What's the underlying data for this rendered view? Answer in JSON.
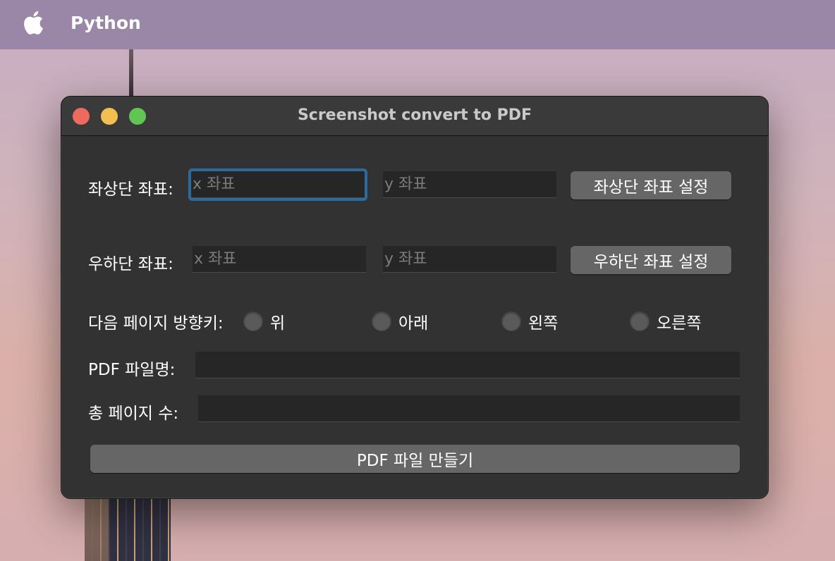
{
  "menubar": {
    "app_name": "Python"
  },
  "window": {
    "title": "Screenshot convert to PDF",
    "top_left": {
      "label": "좌상단 좌표:",
      "x_placeholder": "x 좌표",
      "y_placeholder": "y 좌표",
      "button_label": "좌상단 좌표 설정"
    },
    "bottom_right": {
      "label": "우하단 좌표:",
      "x_placeholder": "x 좌표",
      "y_placeholder": "y 좌표",
      "button_label": "우하단 좌표 설정"
    },
    "direction": {
      "label": "다음 페이지 방향키:",
      "options": [
        "위",
        "아래",
        "왼쪽",
        "오른쪽"
      ]
    },
    "pdf_name": {
      "label": "PDF 파일명:",
      "value": ""
    },
    "total_pages": {
      "label": "총 페이지 수:",
      "value": ""
    },
    "create_button_label": "PDF 파일 만들기"
  },
  "colors": {
    "window_bg": "#323232",
    "focus_ring": "#2a6a9c",
    "button_bg": "#666666",
    "close": "#ed6a5e",
    "minimize": "#f5bf4f",
    "maximize": "#61c554"
  }
}
